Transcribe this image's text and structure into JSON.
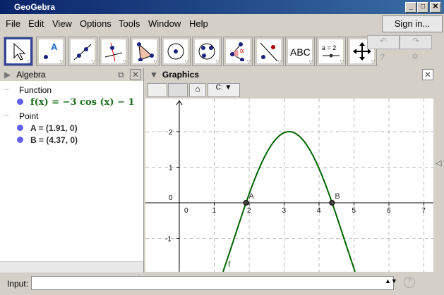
{
  "window": {
    "title": "GeoGebra"
  },
  "menu": [
    "File",
    "Edit",
    "View",
    "Options",
    "Tools",
    "Window",
    "Help"
  ],
  "sign_in": "Sign in...",
  "toolbar": [
    "Move",
    "Point",
    "Line",
    "Perpendicular Line",
    "Polygon",
    "Circle with Center",
    "Circle through 3 Points",
    "Angle",
    "Reflect",
    "Text",
    "Slider",
    "Move Graphics View"
  ],
  "toolbar_text": {
    "text_tool": "ABC",
    "slider_tool": "a = 2"
  },
  "algebra": {
    "title": "Algebra",
    "groups": [
      {
        "label": "Function",
        "items": [
          "f(x) = −3 cos (x) − 1"
        ]
      },
      {
        "label": "Point",
        "items": [
          "A = (1.91, 0)",
          "B = (4.37, 0)"
        ]
      }
    ]
  },
  "graphics": {
    "title": "Graphics",
    "function": {
      "label": "f",
      "a": -3,
      "c": -1
    },
    "points": [
      {
        "label": "A",
        "x": 1.91,
        "y": 0
      },
      {
        "label": "B",
        "x": 4.37,
        "y": 0
      }
    ],
    "x_ticks": [
      "0",
      "1",
      "2",
      "3",
      "4",
      "5",
      "6",
      "7"
    ],
    "y_ticks": [
      "2",
      "1",
      "0",
      "-1"
    ],
    "curve_color": "#006400"
  },
  "input": {
    "label": "Input:",
    "value": ""
  }
}
